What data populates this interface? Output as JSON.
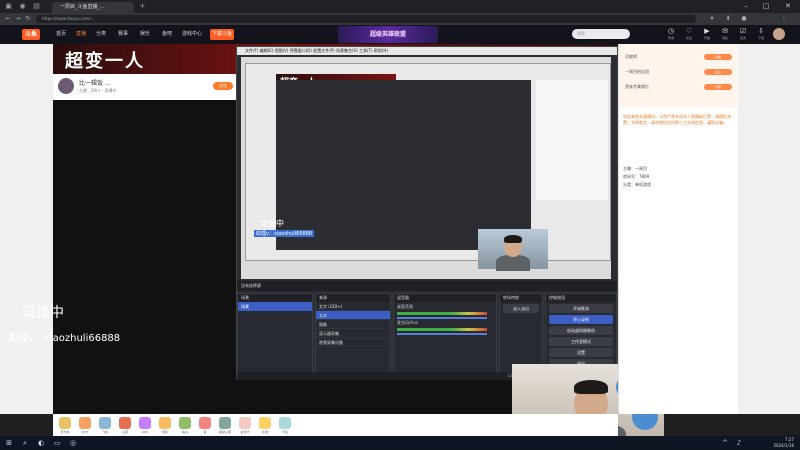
{
  "browser": {
    "tab_title": "一周目_斗鱼直播_...",
    "url": "https://www.douyu.com/...",
    "window_minimize": "–",
    "window_maximize": "□",
    "window_close": "✕"
  },
  "site": {
    "logo": "斗鱼",
    "nav": [
      "首页",
      "直播",
      "分类",
      "赛事",
      "娱乐",
      "鱼吧",
      "游戏中心",
      "下载斗鱼"
    ],
    "active_nav_index": 1,
    "center_banner": "超级英雄联盟",
    "search_placeholder": "搜索",
    "header_icons": [
      "历史",
      "关注",
      "开播",
      "消息",
      "任务",
      "下载"
    ]
  },
  "room": {
    "banner_title": "超变一人",
    "name": "比一辑饭 ...",
    "sub": "主播 · 2W+ · 直播中",
    "follow": "关注"
  },
  "stream": {
    "overlay_line1": "弯播中",
    "overlay_line2": "助理v：xiaozhuli66888",
    "inner_caption1": "弯播中",
    "inner_caption2": "助理v：xiaozhuli66888",
    "inner_banner": "超变一人"
  },
  "obs": {
    "menu": "文件(F)  编辑(E)  视图(V)  停靠窗口(D)  配置文件(P)  场景集合(S)  工具(T)  帮助(H)",
    "toolbar": "没有选择源",
    "docks": {
      "scenes_title": "场景",
      "sources_title": "来源",
      "mixer_title": "混音器",
      "transitions_title": "转场特效",
      "controls_title": "控制按钮"
    },
    "scenes": [
      "场景"
    ],
    "sources": [
      "文字 (GDI+)",
      "文本",
      "图像",
      "显示器采集",
      "视频采集设备"
    ],
    "mixer": [
      "桌面音频",
      "麦克风/Aux"
    ],
    "transition": "淡入淡出",
    "controls": [
      "开始推流",
      "停止录制",
      "启动虚拟摄像机",
      "工作室模式",
      "设置",
      "退出"
    ],
    "status": "LIVE: 00:23:41   REC: 00:00:00   CPU: 3.2%, 30.00 fps"
  },
  "chat": {
    "rows": [
      {
        "text": "贡献榜",
        "pill": "查看"
      },
      {
        "text": "一周目粉丝团",
        "pill": "加入"
      },
      {
        "text": "贵族专属席位",
        "pill": "开通"
      }
    ],
    "notice": "欢迎来到本直播间，斗鱼严禁未成年人直播或打赏，请理性消费，文明发言，请勿相信任何第三方交易信息，谨防诈骗。",
    "meta": [
      "主播：一周目",
      "房间号：7869",
      "分类：单机游戏"
    ]
  },
  "gifts": [
    "荧光棒",
    "办卡",
    "飞机",
    "火箭",
    "666",
    "弱鸡",
    "鱼丸",
    "赞",
    "超级火箭",
    "嘉年华",
    "礼物",
    "背包"
  ],
  "taskbar": {
    "time": "7:27",
    "date": "2024/1/16"
  }
}
